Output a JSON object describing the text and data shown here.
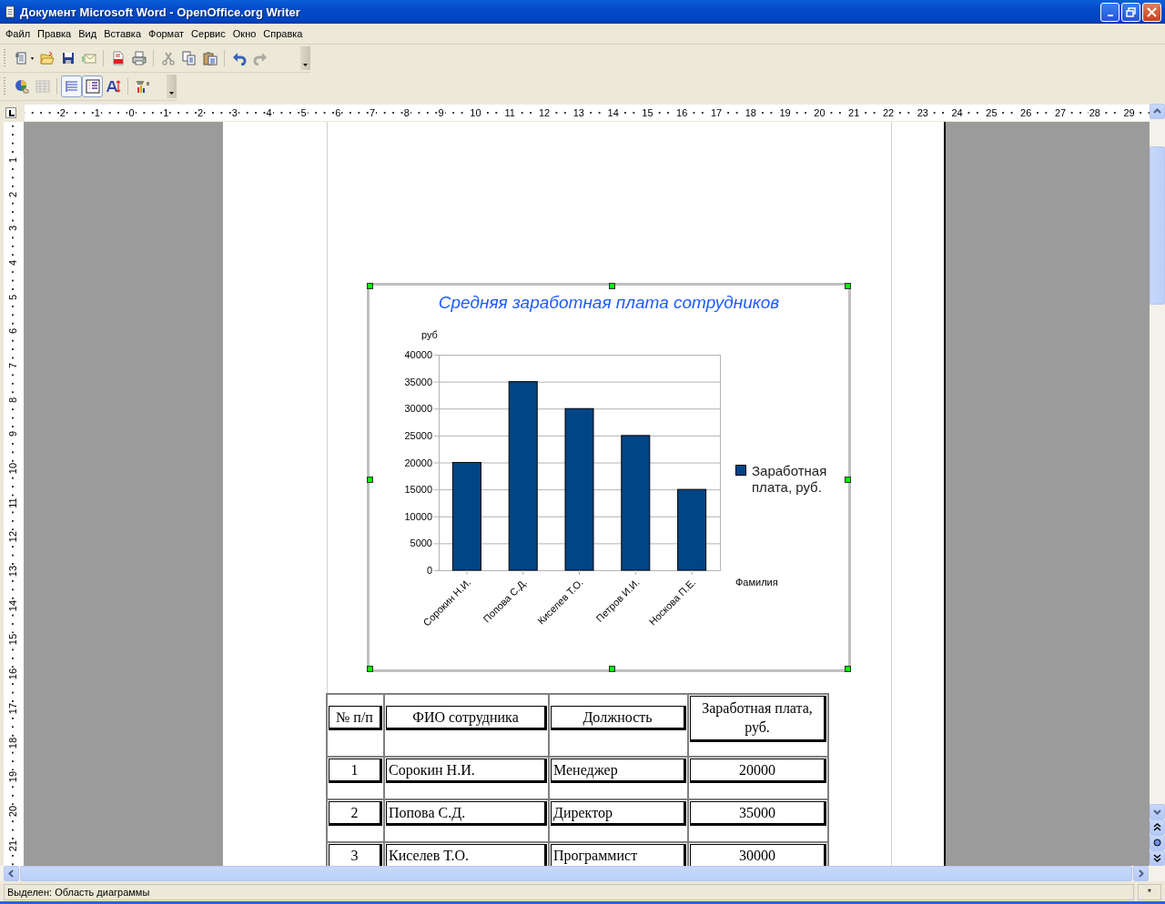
{
  "window": {
    "title": "Документ Microsoft Word - OpenOffice.org Writer"
  },
  "menu": [
    "Файл",
    "Правка",
    "Вид",
    "Вставка",
    "Формат",
    "Сервис",
    "Окно",
    "Справка"
  ],
  "toolbars": [
    {
      "groups": [
        [
          {
            "kind": "new",
            "disabled": false
          },
          {
            "kind": "open",
            "disabled": false
          },
          {
            "kind": "save",
            "disabled": false
          },
          {
            "kind": "mail",
            "disabled": false
          }
        ],
        [
          {
            "kind": "pdf",
            "disabled": false
          },
          {
            "kind": "print",
            "disabled": false
          }
        ],
        [
          {
            "kind": "cut",
            "disabled": true
          },
          {
            "kind": "copy",
            "disabled": false
          },
          {
            "kind": "paste",
            "disabled": false
          }
        ],
        [
          {
            "kind": "undo",
            "disabled": false
          },
          {
            "kind": "redo",
            "disabled": true
          }
        ]
      ]
    },
    {
      "groups": [
        [
          {
            "kind": "chart-type",
            "disabled": false,
            "on": false
          },
          {
            "kind": "data-table",
            "disabled": true,
            "on": false
          }
        ],
        [
          {
            "kind": "rows",
            "disabled": false,
            "on": true
          },
          {
            "kind": "columns",
            "disabled": false,
            "on": true
          },
          {
            "kind": "title",
            "disabled": false,
            "on": false
          }
        ],
        [
          {
            "kind": "legend",
            "disabled": false,
            "on": false
          }
        ]
      ]
    }
  ],
  "ruler": {
    "h_labels": [
      "2",
      "1",
      "0",
      "1",
      "2",
      "3",
      "4",
      "5",
      "6",
      "7",
      "8",
      "9",
      "10",
      "11",
      "12",
      "13",
      "14",
      "15",
      "16",
      "17",
      "18",
      "19",
      "20",
      "21",
      "22",
      "23",
      "24",
      "25",
      "26",
      "27",
      "28",
      "29"
    ],
    "v_labels": [
      "1",
      "2",
      "3",
      "4",
      "5",
      "6",
      "7",
      "8",
      "9",
      "10",
      "11",
      "12",
      "13",
      "14",
      "15",
      "16",
      "17",
      "18",
      "19",
      "20",
      "21"
    ]
  },
  "document": {
    "chart": {
      "selected": true,
      "chart_data": {
        "type": "bar",
        "title": "Средняя заработная плата сотрудников",
        "xlabel": "Фамилия",
        "ylabel": "руб",
        "categories": [
          "Сорокин Н.И.",
          "Попова С.Д.",
          "Киселев Т.О.",
          "Петров И.И.",
          "Носкова П.Е."
        ],
        "series": [
          {
            "name": "Заработная плата, руб.",
            "color": "#004586",
            "values": [
              20000,
              35000,
              30000,
              25000,
              15000
            ]
          }
        ],
        "grid": true,
        "ylim": [
          0,
          40000
        ],
        "yticks": [
          0,
          5000,
          10000,
          15000,
          20000,
          25000,
          30000,
          35000,
          40000
        ]
      }
    },
    "table": {
      "columns": [
        "№ п/п",
        "ФИО сотрудника",
        "Должность",
        "Заработная плата, руб."
      ],
      "rows": [
        [
          "1",
          "Сорокин Н.И.",
          "Менеджер",
          "20000"
        ],
        [
          "2",
          "Попова С.Д.",
          "Директор",
          "35000"
        ],
        [
          "3",
          "Киселев Т.О.",
          "Программист",
          "30000"
        ]
      ]
    }
  },
  "status_bar": {
    "text": "Выделен: Область диаграммы",
    "modified": "*"
  }
}
